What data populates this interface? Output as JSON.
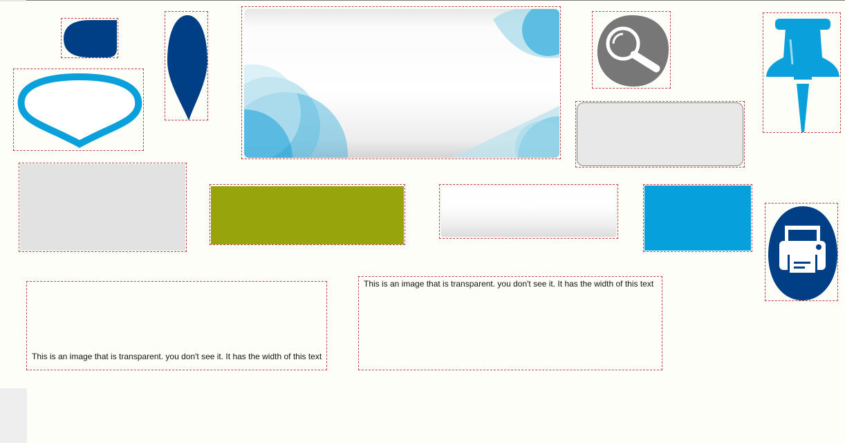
{
  "colors": {
    "dark_blue": "#003f85",
    "light_blue": "#0aa0dc",
    "gray_icon": "#777777",
    "olive": "#98a40c",
    "light_gray": "#e2e2e2",
    "rounded_gray": "#e8e8e8",
    "bright_blue": "#06a0dc",
    "dash_border": "#c0424a"
  },
  "icons": {
    "drop": "drop-shape-icon",
    "leaf": "leaf-shape-icon",
    "speech": "speech-balloon-shape-icon",
    "search": "search-icon",
    "pin": "push-pin-icon",
    "printer": "printer-icon"
  },
  "captions": {
    "bottom_aligned": "This is an image that is transparent. you don't see it. It has the width of this text",
    "top_aligned": "This is an image that is transparent. you don't see it. It has the width of this text"
  }
}
